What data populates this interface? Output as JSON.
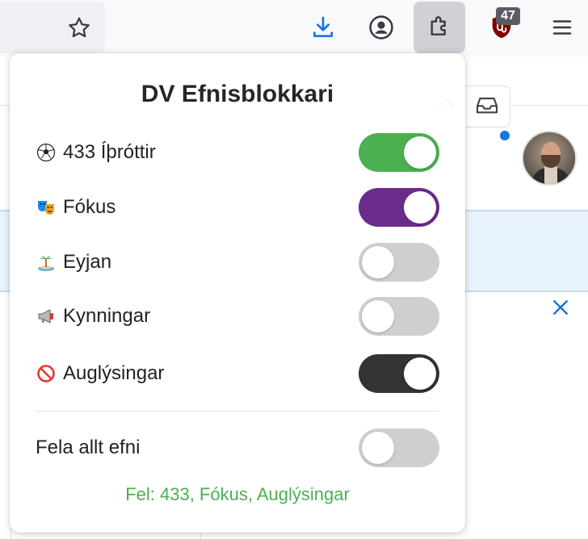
{
  "popup": {
    "title": "DV Efnisblokkari",
    "toggles": [
      {
        "label": "433 Íþróttir",
        "icon": "soccer-ball-icon",
        "state": "on",
        "color": "#4caf50"
      },
      {
        "label": "Fókus",
        "icon": "theater-masks-icon",
        "state": "on",
        "color": "#6a2c8a"
      },
      {
        "label": "Eyjan",
        "icon": "island-icon",
        "state": "off",
        "color": "#cfcfcf"
      },
      {
        "label": "Kynningar",
        "icon": "megaphone-icon",
        "state": "off",
        "color": "#cfcfcf"
      },
      {
        "label": "Auglýsingar",
        "icon": "no-entry-icon",
        "state": "on",
        "color": "#333333"
      }
    ],
    "hide_all": {
      "label": "Fela allt efni",
      "state": "off"
    },
    "status": "Fel: 433, Fókus, Auglýsingar",
    "status_color": "#4caf50"
  },
  "toolbar": {
    "extension_badge": "47",
    "icons": [
      "bookmark-star-icon",
      "download-icon",
      "account-icon",
      "extensions-icon",
      "ublock-icon",
      "menu-icon"
    ]
  }
}
